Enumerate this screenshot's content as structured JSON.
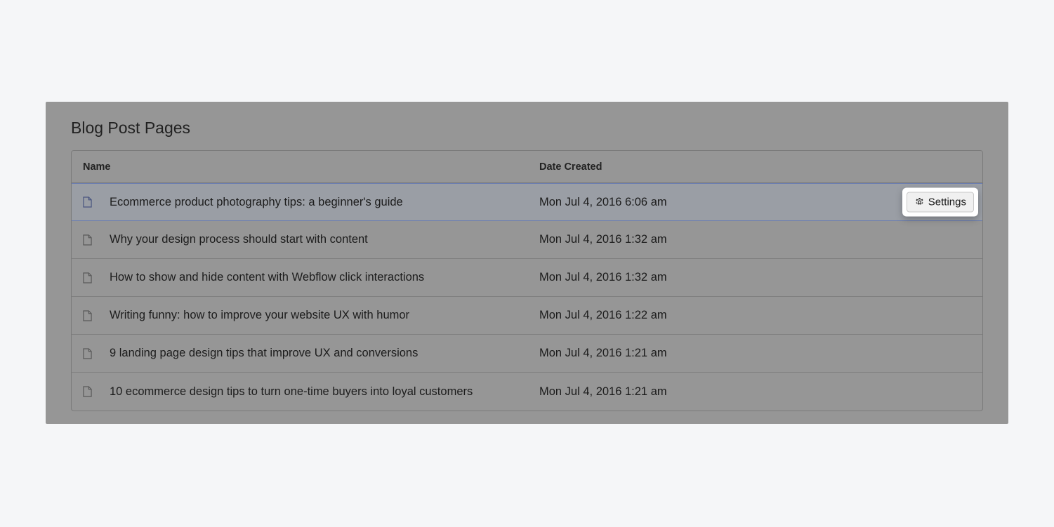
{
  "panel": {
    "title": "Blog Post Pages",
    "columns": {
      "name": "Name",
      "date": "Date Created"
    },
    "settings_label": "Settings",
    "rows": [
      {
        "name": "Ecommerce product photography tips: a beginner's guide",
        "date": "Mon Jul 4, 2016 6:06 am",
        "selected": true
      },
      {
        "name": "Why your design process should start with content",
        "date": "Mon Jul 4, 2016 1:32 am",
        "selected": false
      },
      {
        "name": "How to show and hide content with Webflow click interactions",
        "date": "Mon Jul 4, 2016 1:32 am",
        "selected": false
      },
      {
        "name": "Writing funny: how to improve your website UX with humor",
        "date": "Mon Jul 4, 2016 1:22 am",
        "selected": false
      },
      {
        "name": "9 landing page design tips that improve UX and conversions",
        "date": "Mon Jul 4, 2016 1:21 am",
        "selected": false
      },
      {
        "name": "10 ecommerce design tips to turn one-time buyers into loyal customers",
        "date": "Mon Jul 4, 2016 1:21 am",
        "selected": false
      }
    ]
  }
}
